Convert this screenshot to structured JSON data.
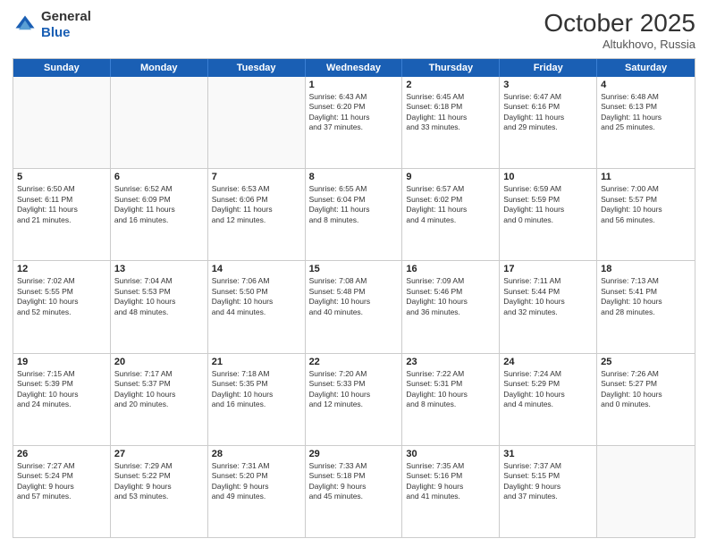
{
  "header": {
    "logo_general": "General",
    "logo_blue": "Blue",
    "month_title": "October 2025",
    "location": "Altukhovo, Russia"
  },
  "days_of_week": [
    "Sunday",
    "Monday",
    "Tuesday",
    "Wednesday",
    "Thursday",
    "Friday",
    "Saturday"
  ],
  "weeks": [
    [
      {
        "day": "",
        "text": ""
      },
      {
        "day": "",
        "text": ""
      },
      {
        "day": "",
        "text": ""
      },
      {
        "day": "1",
        "text": "Sunrise: 6:43 AM\nSunset: 6:20 PM\nDaylight: 11 hours\nand 37 minutes."
      },
      {
        "day": "2",
        "text": "Sunrise: 6:45 AM\nSunset: 6:18 PM\nDaylight: 11 hours\nand 33 minutes."
      },
      {
        "day": "3",
        "text": "Sunrise: 6:47 AM\nSunset: 6:16 PM\nDaylight: 11 hours\nand 29 minutes."
      },
      {
        "day": "4",
        "text": "Sunrise: 6:48 AM\nSunset: 6:13 PM\nDaylight: 11 hours\nand 25 minutes."
      }
    ],
    [
      {
        "day": "5",
        "text": "Sunrise: 6:50 AM\nSunset: 6:11 PM\nDaylight: 11 hours\nand 21 minutes."
      },
      {
        "day": "6",
        "text": "Sunrise: 6:52 AM\nSunset: 6:09 PM\nDaylight: 11 hours\nand 16 minutes."
      },
      {
        "day": "7",
        "text": "Sunrise: 6:53 AM\nSunset: 6:06 PM\nDaylight: 11 hours\nand 12 minutes."
      },
      {
        "day": "8",
        "text": "Sunrise: 6:55 AM\nSunset: 6:04 PM\nDaylight: 11 hours\nand 8 minutes."
      },
      {
        "day": "9",
        "text": "Sunrise: 6:57 AM\nSunset: 6:02 PM\nDaylight: 11 hours\nand 4 minutes."
      },
      {
        "day": "10",
        "text": "Sunrise: 6:59 AM\nSunset: 5:59 PM\nDaylight: 11 hours\nand 0 minutes."
      },
      {
        "day": "11",
        "text": "Sunrise: 7:00 AM\nSunset: 5:57 PM\nDaylight: 10 hours\nand 56 minutes."
      }
    ],
    [
      {
        "day": "12",
        "text": "Sunrise: 7:02 AM\nSunset: 5:55 PM\nDaylight: 10 hours\nand 52 minutes."
      },
      {
        "day": "13",
        "text": "Sunrise: 7:04 AM\nSunset: 5:53 PM\nDaylight: 10 hours\nand 48 minutes."
      },
      {
        "day": "14",
        "text": "Sunrise: 7:06 AM\nSunset: 5:50 PM\nDaylight: 10 hours\nand 44 minutes."
      },
      {
        "day": "15",
        "text": "Sunrise: 7:08 AM\nSunset: 5:48 PM\nDaylight: 10 hours\nand 40 minutes."
      },
      {
        "day": "16",
        "text": "Sunrise: 7:09 AM\nSunset: 5:46 PM\nDaylight: 10 hours\nand 36 minutes."
      },
      {
        "day": "17",
        "text": "Sunrise: 7:11 AM\nSunset: 5:44 PM\nDaylight: 10 hours\nand 32 minutes."
      },
      {
        "day": "18",
        "text": "Sunrise: 7:13 AM\nSunset: 5:41 PM\nDaylight: 10 hours\nand 28 minutes."
      }
    ],
    [
      {
        "day": "19",
        "text": "Sunrise: 7:15 AM\nSunset: 5:39 PM\nDaylight: 10 hours\nand 24 minutes."
      },
      {
        "day": "20",
        "text": "Sunrise: 7:17 AM\nSunset: 5:37 PM\nDaylight: 10 hours\nand 20 minutes."
      },
      {
        "day": "21",
        "text": "Sunrise: 7:18 AM\nSunset: 5:35 PM\nDaylight: 10 hours\nand 16 minutes."
      },
      {
        "day": "22",
        "text": "Sunrise: 7:20 AM\nSunset: 5:33 PM\nDaylight: 10 hours\nand 12 minutes."
      },
      {
        "day": "23",
        "text": "Sunrise: 7:22 AM\nSunset: 5:31 PM\nDaylight: 10 hours\nand 8 minutes."
      },
      {
        "day": "24",
        "text": "Sunrise: 7:24 AM\nSunset: 5:29 PM\nDaylight: 10 hours\nand 4 minutes."
      },
      {
        "day": "25",
        "text": "Sunrise: 7:26 AM\nSunset: 5:27 PM\nDaylight: 10 hours\nand 0 minutes."
      }
    ],
    [
      {
        "day": "26",
        "text": "Sunrise: 7:27 AM\nSunset: 5:24 PM\nDaylight: 9 hours\nand 57 minutes."
      },
      {
        "day": "27",
        "text": "Sunrise: 7:29 AM\nSunset: 5:22 PM\nDaylight: 9 hours\nand 53 minutes."
      },
      {
        "day": "28",
        "text": "Sunrise: 7:31 AM\nSunset: 5:20 PM\nDaylight: 9 hours\nand 49 minutes."
      },
      {
        "day": "29",
        "text": "Sunrise: 7:33 AM\nSunset: 5:18 PM\nDaylight: 9 hours\nand 45 minutes."
      },
      {
        "day": "30",
        "text": "Sunrise: 7:35 AM\nSunset: 5:16 PM\nDaylight: 9 hours\nand 41 minutes."
      },
      {
        "day": "31",
        "text": "Sunrise: 7:37 AM\nSunset: 5:15 PM\nDaylight: 9 hours\nand 37 minutes."
      },
      {
        "day": "",
        "text": ""
      }
    ]
  ]
}
